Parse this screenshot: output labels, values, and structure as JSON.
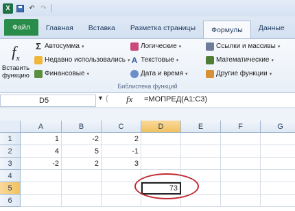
{
  "qat": {
    "logo": "X",
    "undo": "↶",
    "redo": "↷"
  },
  "tabs": [
    "Файл",
    "Главная",
    "Вставка",
    "Разметка страницы",
    "Формулы",
    "Данные"
  ],
  "ribbon": {
    "insert_function": "Вставить функцию",
    "col1": [
      "Автосумма",
      "Недавно использовались",
      "Финансовые"
    ],
    "col2": [
      "Логические",
      "Текстовые",
      "Дата и время"
    ],
    "col3": [
      "Ссылки и массивы",
      "Математические",
      "Другие функции"
    ],
    "group_label": "Библиотека функций"
  },
  "formula_bar": {
    "name_box": "D5",
    "fx": "fx",
    "formula": "=МОПРЕД(A1:C3)"
  },
  "grid": {
    "columns": [
      "A",
      "B",
      "C",
      "D",
      "E",
      "F",
      "G"
    ],
    "rows": [
      "1",
      "2",
      "3",
      "4",
      "5",
      "6"
    ],
    "cells": [
      [
        "1",
        "-2",
        "2",
        "",
        "",
        "",
        ""
      ],
      [
        "4",
        "5",
        "-1",
        "",
        "",
        "",
        ""
      ],
      [
        "-2",
        "2",
        "3",
        "",
        "",
        "",
        ""
      ],
      [
        "",
        "",
        "",
        "",
        "",
        "",
        ""
      ],
      [
        "",
        "",
        "",
        "73",
        "",
        "",
        ""
      ],
      [
        "",
        "",
        "",
        "",
        "",
        "",
        ""
      ]
    ],
    "active_cell": "D5"
  },
  "colors": {
    "file_tab": "#2a8c4a",
    "annotation": "#c0282f"
  }
}
